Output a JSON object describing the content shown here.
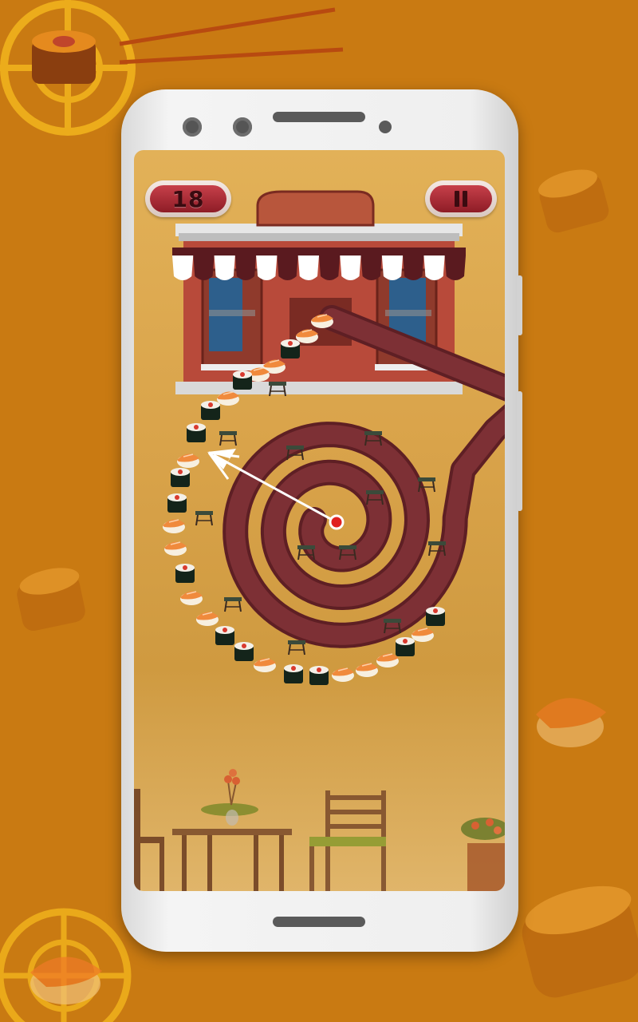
{
  "game": {
    "score": "18",
    "pause_icon": "pause-icon"
  },
  "colors": {
    "background": "#c97a12",
    "track": "#7a2a30",
    "button_red": "#a82a34",
    "aim_dot": "#e02020"
  }
}
